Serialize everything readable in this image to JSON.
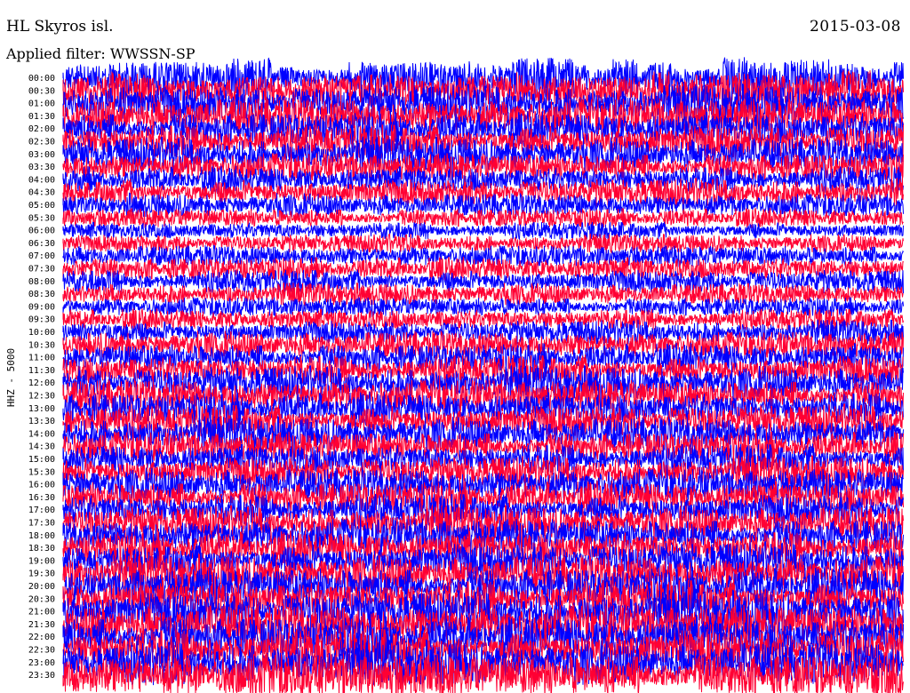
{
  "header": {
    "station": "HL Skyros isl.",
    "date": "2015-03-08",
    "filter": "Applied filter: WWSSN-SP"
  },
  "chart_data": {
    "type": "line",
    "title": "HL Skyros isl.",
    "ylabel": "HHZ - 5000",
    "row_labels": [
      "00:00",
      "00:30",
      "01:00",
      "01:30",
      "02:00",
      "02:30",
      "03:00",
      "03:30",
      "04:00",
      "04:30",
      "05:00",
      "05:30",
      "06:00",
      "06:30",
      "07:00",
      "07:30",
      "08:00",
      "08:30",
      "09:00",
      "09:30",
      "10:00",
      "10:30",
      "11:00",
      "11:30",
      "12:00",
      "12:30",
      "13:00",
      "13:30",
      "14:00",
      "14:30",
      "15:00",
      "15:30",
      "16:00",
      "16:30",
      "17:00",
      "17:30",
      "18:00",
      "18:30",
      "19:00",
      "19:30",
      "20:00",
      "20:30",
      "21:00",
      "21:30",
      "22:00",
      "22:30",
      "23:00",
      "23:30"
    ],
    "trace_colors": [
      "#0000ff",
      "#ff0033"
    ],
    "relative_amplitude": [
      1.0,
      1.0,
      0.95,
      0.95,
      0.9,
      0.9,
      0.85,
      0.75,
      0.7,
      0.7,
      0.6,
      0.5,
      0.45,
      0.45,
      0.55,
      0.6,
      0.6,
      0.55,
      0.5,
      0.55,
      0.6,
      0.7,
      0.75,
      0.8,
      0.85,
      0.85,
      0.85,
      0.85,
      0.85,
      0.8,
      0.8,
      0.8,
      0.85,
      0.85,
      0.85,
      0.85,
      0.9,
      0.9,
      0.95,
      0.95,
      1.0,
      1.0,
      1.05,
      1.05,
      1.1,
      1.1,
      1.1,
      1.15
    ],
    "grid": false
  },
  "colors": {
    "background": "#ffffff",
    "text": "#000000"
  }
}
